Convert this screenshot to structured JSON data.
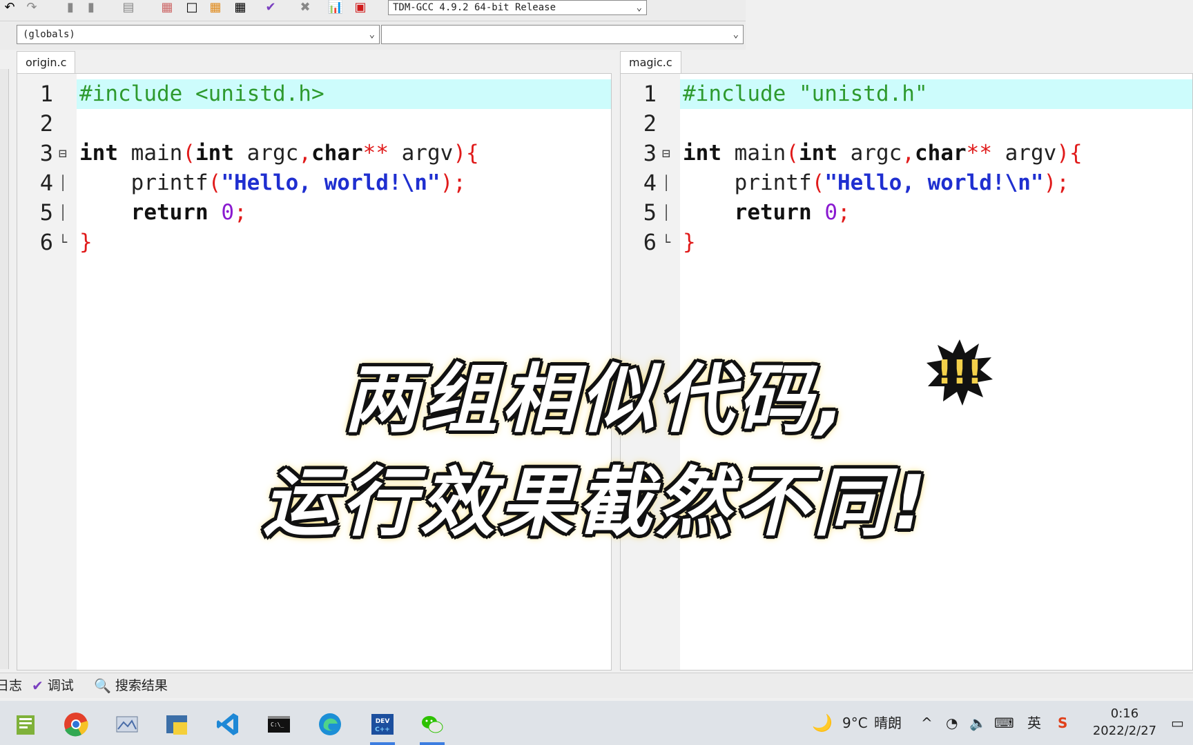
{
  "toolbar": {
    "compiler": "TDM-GCC 4.9.2 64-bit Release"
  },
  "combos": {
    "scope": "(globals)",
    "member": ""
  },
  "panes": [
    {
      "tab": "origin.c",
      "lines": [
        {
          "num": "1",
          "tokens": [
            {
              "c": "pp",
              "t": "#include <unistd.h>"
            }
          ]
        },
        {
          "num": "2",
          "tokens": []
        },
        {
          "num": "3",
          "tokens": [
            {
              "c": "kw",
              "t": "int"
            },
            {
              "c": "",
              "t": " main"
            },
            {
              "c": "sym",
              "t": "("
            },
            {
              "c": "kw",
              "t": "int"
            },
            {
              "c": "",
              "t": " argc"
            },
            {
              "c": "sym",
              "t": ","
            },
            {
              "c": "kw",
              "t": "char"
            },
            {
              "c": "sym",
              "t": "**"
            },
            {
              "c": "",
              "t": " argv"
            },
            {
              "c": "sym",
              "t": "){"
            }
          ]
        },
        {
          "num": "4",
          "tokens": [
            {
              "c": "",
              "t": "    printf"
            },
            {
              "c": "sym",
              "t": "("
            },
            {
              "c": "str",
              "t": "\"Hello, world!\\n\""
            },
            {
              "c": "sym",
              "t": ");"
            }
          ]
        },
        {
          "num": "5",
          "tokens": [
            {
              "c": "",
              "t": "    "
            },
            {
              "c": "kw",
              "t": "return"
            },
            {
              "c": "",
              "t": " "
            },
            {
              "c": "num",
              "t": "0"
            },
            {
              "c": "sym",
              "t": ";"
            }
          ]
        },
        {
          "num": "6",
          "tokens": [
            {
              "c": "sym",
              "t": "}"
            }
          ]
        }
      ]
    },
    {
      "tab": "magic.c",
      "lines": [
        {
          "num": "1",
          "tokens": [
            {
              "c": "pp",
              "t": "#include \"unistd.h\""
            }
          ]
        },
        {
          "num": "2",
          "tokens": []
        },
        {
          "num": "3",
          "tokens": [
            {
              "c": "kw",
              "t": "int"
            },
            {
              "c": "",
              "t": " main"
            },
            {
              "c": "sym",
              "t": "("
            },
            {
              "c": "kw",
              "t": "int"
            },
            {
              "c": "",
              "t": " argc"
            },
            {
              "c": "sym",
              "t": ","
            },
            {
              "c": "kw",
              "t": "char"
            },
            {
              "c": "sym",
              "t": "**"
            },
            {
              "c": "",
              "t": " argv"
            },
            {
              "c": "sym",
              "t": "){"
            }
          ]
        },
        {
          "num": "4",
          "tokens": [
            {
              "c": "",
              "t": "    printf"
            },
            {
              "c": "sym",
              "t": "("
            },
            {
              "c": "str",
              "t": "\"Hello, world!\\n\""
            },
            {
              "c": "sym",
              "t": ");"
            }
          ]
        },
        {
          "num": "5",
          "tokens": [
            {
              "c": "",
              "t": "    "
            },
            {
              "c": "kw",
              "t": "return"
            },
            {
              "c": "",
              "t": " "
            },
            {
              "c": "num",
              "t": "0"
            },
            {
              "c": "sym",
              "t": ";"
            }
          ]
        },
        {
          "num": "6",
          "tokens": [
            {
              "c": "sym",
              "t": "}"
            }
          ]
        }
      ]
    }
  ],
  "caption": {
    "line1": "两组相似代码,",
    "line2": "运行效果截然不同!"
  },
  "bottom_tabs": {
    "log": "日志",
    "debug": "调试",
    "search_results": "搜索结果"
  },
  "tray": {
    "temperature": "9°C",
    "weather": "晴朗",
    "ime": "英",
    "time": "0:16",
    "date": "2022/2/27"
  },
  "colors": {
    "line_highlight": "#cdfcfc",
    "preprocessor": "#2e9a2e",
    "string": "#1f2fd0",
    "symbol": "#e01a1a",
    "number": "#8a1ad0",
    "caption_glow": "#f3d04a"
  }
}
